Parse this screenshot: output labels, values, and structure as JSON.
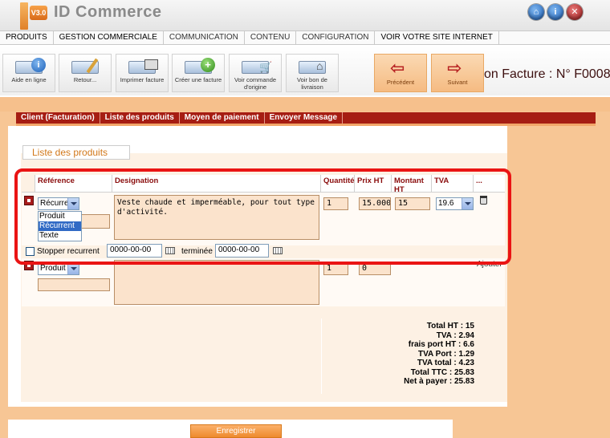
{
  "app": {
    "logo_badge": "V3.0",
    "title": "ID Commerce"
  },
  "header_icons": [
    "home-icon",
    "info-icon",
    "close-icon"
  ],
  "menu": [
    "PRODUITS",
    "GESTION COMMERCIALE",
    "COMMUNICATION",
    "CONTENU",
    "CONFIGURATION",
    "VOIR VOTRE SITE INTERNET"
  ],
  "toolbar": {
    "help": "Aide en ligne",
    "back": "Retour...",
    "print": "Imprimer facture",
    "create": "Créer une facture",
    "order": "Voir commande d'origine",
    "delivery": "Voir bon de livraison",
    "previous": "Précédent",
    "next": "Suivant"
  },
  "page_title": "on Facture : N° F0008",
  "tabs": [
    "Client (Facturation)",
    "Liste des produits",
    "Moyen de paiement",
    "Envoyer Message"
  ],
  "section_title": "Liste des produits",
  "columns": [
    "Référence",
    "Designation",
    "Quantité",
    "Prix HT",
    "Montant HT",
    "TVA",
    "..."
  ],
  "row1": {
    "type_selected": "Récurre",
    "dropdown_options": [
      "Produit",
      "Récurrent",
      "Texte"
    ],
    "dropdown_selected_index": 1,
    "designation": "Veste  chaude et imperméable, pour tout type d'activité.",
    "quantity": "1",
    "price_ht": "15.0000",
    "amount_ht": "15",
    "tva": "19.6",
    "stop_recurrent_label": "Stopper recurrent",
    "start_date": "0000-00-00",
    "ended_label": "terminée",
    "end_date": "0000-00-00"
  },
  "row2": {
    "type_selected": "Produit",
    "quantity": "1",
    "price_ht": "0",
    "add_label": "Ajouter"
  },
  "totals": [
    "Total HT : 15",
    "TVA : 2.94",
    "frais port HT : 6.6",
    "TVA Port : 1.29",
    "TVA total : 4.23",
    "Total TTC : 25.83",
    "Net à payer : 25.83"
  ],
  "save_label": "Enregistrer"
}
